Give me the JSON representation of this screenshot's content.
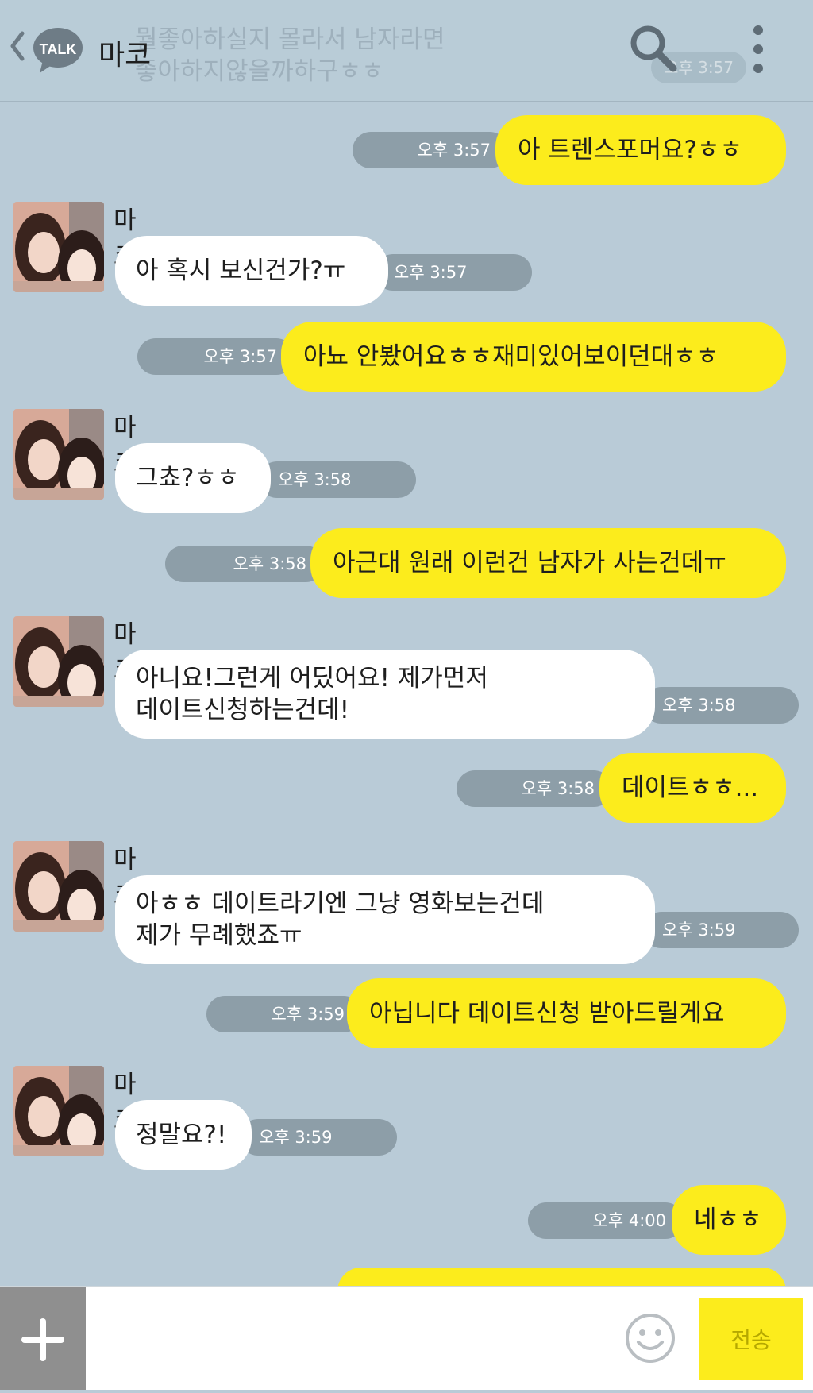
{
  "header": {
    "title": "마코",
    "logo_text": "TALK",
    "ghost_preview": "뭘좋아하실지 몰라서 남자라면\n좋아하지않을까하구ㅎㅎ",
    "ghost_time": "오후 3:57"
  },
  "messages": [
    {
      "side": "me",
      "text": "아 트렌스포머요?ㅎㅎ",
      "time": "오후 3:57"
    },
    {
      "side": "them",
      "sender": "마코",
      "text": "아 혹시 보신건가?ㅠ",
      "time": "오후 3:57"
    },
    {
      "side": "me",
      "text": "아뇨 안봤어요ㅎㅎ재미있어보이던대ㅎㅎ",
      "time": "오후 3:57"
    },
    {
      "side": "them",
      "sender": "마코",
      "text": "그쵸?ㅎㅎ",
      "time": "오후 3:58"
    },
    {
      "side": "me",
      "text": "아근대 원래 이런건 남자가 사는건데ㅠ",
      "time": "오후 3:58"
    },
    {
      "side": "them",
      "sender": "마코",
      "text": "아니요!그런게 어딨어요! 제가먼저\n데이트신청하는건데!",
      "time": "오후 3:58"
    },
    {
      "side": "me",
      "text": "데이트ㅎㅎ...",
      "time": "오후 3:58"
    },
    {
      "side": "them",
      "sender": "마코",
      "text": "아ㅎㅎ 데이트라기엔 그냥 영화보는건데\n제가 무례했죠ㅠ",
      "time": "오후 3:59"
    },
    {
      "side": "me",
      "text": "아닙니다 데이트신청 받아드릴게요",
      "time": "오후 3:59"
    },
    {
      "side": "them",
      "sender": "마코",
      "text": "정말요?!",
      "time": "오후 3:59"
    },
    {
      "side": "me",
      "text": "네ㅎㅎ",
      "time": "오후 4:00"
    }
  ],
  "input": {
    "placeholder": "",
    "send_label": "전송"
  },
  "colors": {
    "background": "#b9cbd7",
    "my_bubble": "#fcec1c",
    "their_bubble": "#ffffff",
    "time_pill": "#8d9ea8",
    "send_button": "#fcec1c"
  },
  "icons": [
    "back-chevron-icon",
    "kakaotalk-logo-icon",
    "search-icon",
    "more-vertical-icon",
    "plus-icon",
    "emoji-icon"
  ]
}
